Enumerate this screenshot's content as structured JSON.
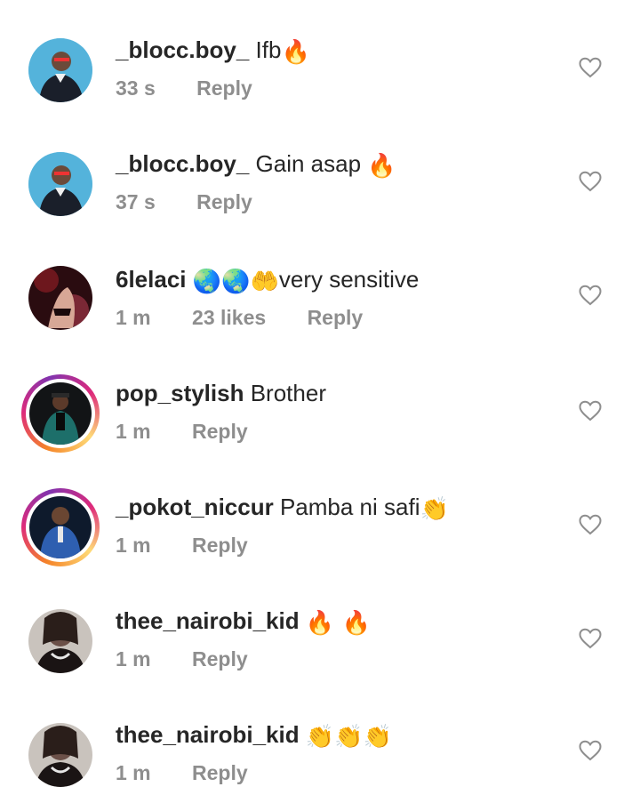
{
  "comments": [
    {
      "username": "_blocc.boy_",
      "text": "Ifb",
      "emoji": "🔥",
      "time": "33 s",
      "likes": "",
      "reply": "Reply",
      "story_ring": false,
      "avatar_color": "#3fa9d6",
      "heart_icon": "heart-outline"
    },
    {
      "username": "_blocc.boy_",
      "text": "Gain asap",
      "emoji": "🔥",
      "time": "37 s",
      "likes": "",
      "reply": "Reply",
      "story_ring": false,
      "avatar_color": "#3fa9d6",
      "heart_icon": "heart-outline"
    },
    {
      "username": "6lelaci",
      "text": "very sensitive",
      "emoji": "🌏🌏🤲",
      "time": "1 m",
      "likes": "23 likes",
      "reply": "Reply",
      "story_ring": false,
      "avatar_color": "#5a1a1e",
      "heart_icon": "heart-outline"
    },
    {
      "username": "pop_stylish",
      "text": "Brother",
      "emoji": "",
      "time": "1 m",
      "likes": "",
      "reply": "Reply",
      "story_ring": true,
      "avatar_color": "#1d6f6a",
      "heart_icon": "heart-outline"
    },
    {
      "username": "_pokot_niccur",
      "text": "Pamba ni safi",
      "emoji": "👏",
      "time": "1 m",
      "likes": "",
      "reply": "Reply",
      "story_ring": true,
      "avatar_color": "#2e5fb0",
      "heart_icon": "heart-outline"
    },
    {
      "username": "thee_nairobi_kid",
      "text": "",
      "emoji": "🔥 🔥",
      "time": "1 m",
      "likes": "",
      "reply": "Reply",
      "story_ring": false,
      "avatar_color": "#6b5048",
      "heart_icon": "heart-outline"
    },
    {
      "username": "thee_nairobi_kid",
      "text": "",
      "emoji": "👏👏👏",
      "time": "1 m",
      "likes": "",
      "reply": "Reply",
      "story_ring": false,
      "avatar_color": "#6b5048",
      "heart_icon": "heart-outline"
    }
  ]
}
